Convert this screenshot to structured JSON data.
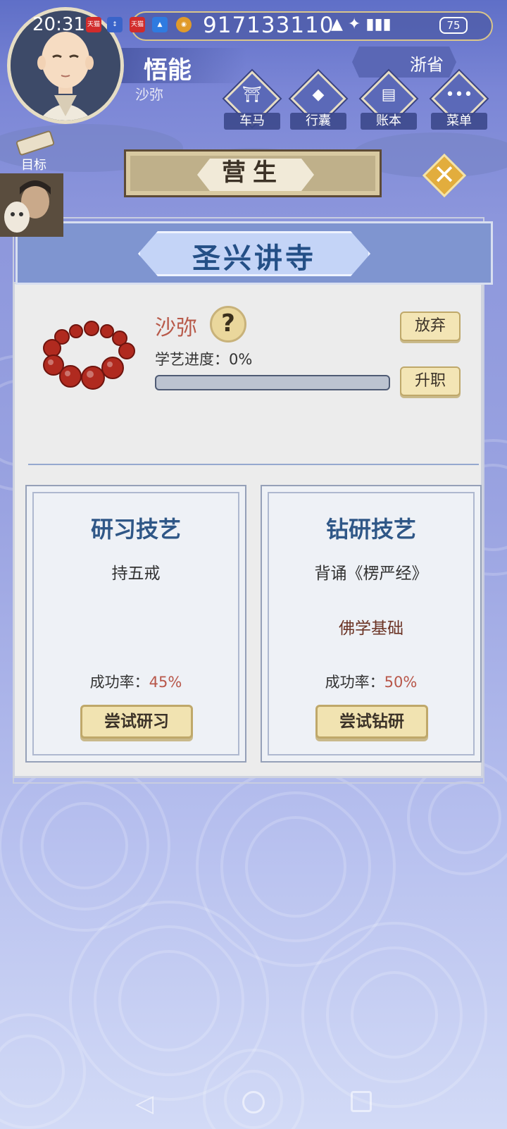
{
  "status_bar": {
    "time": "20:31",
    "battery": "75",
    "app_badge": "天猫"
  },
  "header": {
    "money": "917133110"
  },
  "player": {
    "name": "悟能",
    "rank": "沙弥"
  },
  "region": {
    "label": "浙省"
  },
  "nav": [
    {
      "label": "车马",
      "glyph": "⛩"
    },
    {
      "label": "行囊",
      "glyph": "◆"
    },
    {
      "label": "账本",
      "glyph": "▤"
    },
    {
      "label": "菜单",
      "glyph": "•••"
    }
  ],
  "goal": {
    "label": "目标"
  },
  "banner": {
    "title": "营生"
  },
  "close": {
    "glyph": "✕"
  },
  "location": {
    "title": "圣兴讲寺"
  },
  "job": {
    "title": "沙弥",
    "help": "?",
    "progress_label": "学艺进度：0%",
    "progress_value": 0,
    "abandon_label": "放弃",
    "promote_label": "升职"
  },
  "cards": [
    {
      "title": "研习技艺",
      "item": "持五戒",
      "requirement": "",
      "rate_label": "成功率：",
      "rate_value": "45%",
      "button": "尝试研习"
    },
    {
      "title": "钻研技艺",
      "item": "背诵《楞严经》",
      "requirement": "佛学基础",
      "rate_label": "成功率：",
      "rate_value": "50%",
      "button": "尝试钻研"
    }
  ],
  "colors": {
    "accent_gold": "#e2ad3d",
    "panel_blue": "#7f95d0",
    "title_blue": "#244f86",
    "rate_red": "#b8574a"
  }
}
